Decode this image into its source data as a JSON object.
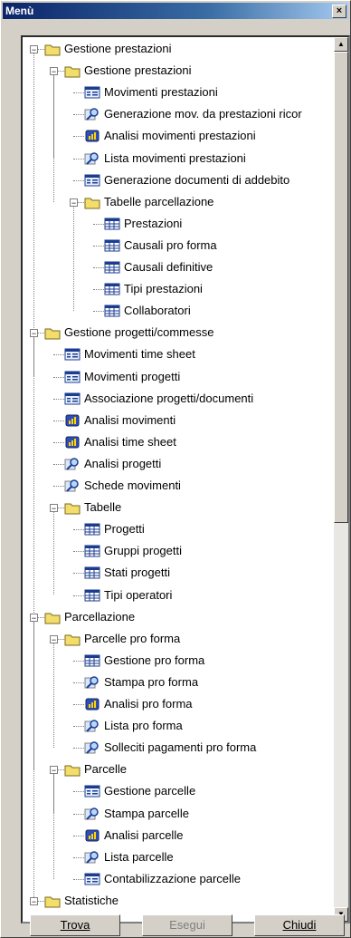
{
  "window": {
    "title": "Menù",
    "close_glyph": "×"
  },
  "buttons": {
    "find": "Trova",
    "execute": "Esegui",
    "close": "Chiudi"
  },
  "colors": {
    "title_bar": "#0a246a",
    "folder": "#f3dd6b",
    "table_icon": "#1c3d8f"
  },
  "tree": [
    {
      "label": "Gestione prestazioni",
      "icon": "folder-icon",
      "level": 0,
      "expanded": true
    },
    {
      "label": "Gestione prestazioni",
      "icon": "folder-icon",
      "level": 1,
      "expanded": true
    },
    {
      "label": "Movimenti prestazioni",
      "icon": "form-icon",
      "level": 2
    },
    {
      "label": "Generazione mov. da prestazioni ricor",
      "icon": "magnifier-icon",
      "level": 2
    },
    {
      "label": "Analisi movimenti prestazioni",
      "icon": "analysis-icon",
      "level": 2
    },
    {
      "label": "Lista movimenti prestazioni",
      "icon": "magnifier-icon",
      "level": 2
    },
    {
      "label": "Generazione documenti di addebito",
      "icon": "form-icon",
      "level": 2
    },
    {
      "label": "Tabelle parcellazione",
      "icon": "folder-icon",
      "level": 2,
      "expanded": true
    },
    {
      "label": "Prestazioni",
      "icon": "table-icon",
      "level": 3
    },
    {
      "label": "Causali pro forma",
      "icon": "table-icon",
      "level": 3
    },
    {
      "label": "Causali definitive",
      "icon": "table-icon",
      "level": 3
    },
    {
      "label": "Tipi prestazioni",
      "icon": "table-icon",
      "level": 3
    },
    {
      "label": "Collaboratori",
      "icon": "table-icon",
      "level": 3
    },
    {
      "label": "Gestione progetti/commesse",
      "icon": "folder-icon",
      "level": 0,
      "expanded": true
    },
    {
      "label": "Movimenti time sheet",
      "icon": "form-icon",
      "level": 1
    },
    {
      "label": "Movimenti progetti",
      "icon": "form-icon",
      "level": 1
    },
    {
      "label": "Associazione progetti/documenti",
      "icon": "form-icon",
      "level": 1
    },
    {
      "label": "Analisi movimenti",
      "icon": "analysis-icon",
      "level": 1
    },
    {
      "label": "Analisi time sheet",
      "icon": "analysis-icon",
      "level": 1
    },
    {
      "label": "Analisi progetti",
      "icon": "magnifier-icon",
      "level": 1
    },
    {
      "label": "Schede movimenti",
      "icon": "magnifier-icon",
      "level": 1
    },
    {
      "label": "Tabelle",
      "icon": "folder-icon",
      "level": 1,
      "expanded": true
    },
    {
      "label": "Progetti",
      "icon": "table-icon",
      "level": 2
    },
    {
      "label": "Gruppi progetti",
      "icon": "table-icon",
      "level": 2
    },
    {
      "label": "Stati progetti",
      "icon": "table-icon",
      "level": 2
    },
    {
      "label": "Tipi operatori",
      "icon": "table-icon",
      "level": 2
    },
    {
      "label": "Parcellazione",
      "icon": "folder-icon",
      "level": 0,
      "expanded": true
    },
    {
      "label": "Parcelle pro forma",
      "icon": "folder-icon",
      "level": 1,
      "expanded": true
    },
    {
      "label": "Gestione pro forma",
      "icon": "table-icon",
      "level": 2
    },
    {
      "label": "Stampa pro forma",
      "icon": "magnifier-icon",
      "level": 2
    },
    {
      "label": "Analisi pro forma",
      "icon": "analysis-icon",
      "level": 2
    },
    {
      "label": "Lista pro forma",
      "icon": "magnifier-icon",
      "level": 2
    },
    {
      "label": "Solleciti pagamenti pro forma",
      "icon": "magnifier-icon",
      "level": 2
    },
    {
      "label": "Parcelle",
      "icon": "folder-icon",
      "level": 1,
      "expanded": true
    },
    {
      "label": "Gestione parcelle",
      "icon": "form-icon",
      "level": 2
    },
    {
      "label": "Stampa parcelle",
      "icon": "magnifier-icon",
      "level": 2
    },
    {
      "label": "Analisi parcelle",
      "icon": "analysis-icon",
      "level": 2
    },
    {
      "label": "Lista parcelle",
      "icon": "magnifier-icon",
      "level": 2
    },
    {
      "label": "Contabilizzazione parcelle",
      "icon": "form-icon",
      "level": 2
    },
    {
      "label": "Statistiche",
      "icon": "folder-icon",
      "level": 0,
      "expanded": true
    }
  ]
}
